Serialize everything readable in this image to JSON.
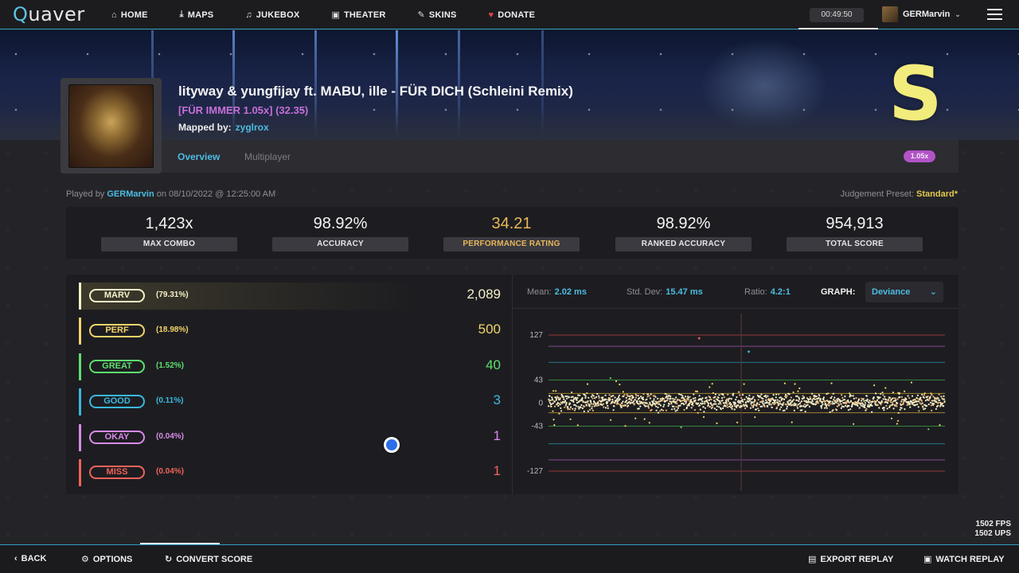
{
  "app": {
    "logo_text": "uaver",
    "logo_q": "Q"
  },
  "nav": {
    "items": [
      {
        "label": "HOME",
        "icon": "home-icon"
      },
      {
        "label": "MAPS",
        "icon": "download-icon"
      },
      {
        "label": "JUKEBOX",
        "icon": "music-icon"
      },
      {
        "label": "THEATER",
        "icon": "camera-icon"
      },
      {
        "label": "SKINS",
        "icon": "brush-icon"
      },
      {
        "label": "DONATE",
        "icon": "heart-icon"
      }
    ],
    "clock": "00:49:50",
    "username": "GERMarvin"
  },
  "map": {
    "title": "lityway & yungfijay ft. MABU, ille - FÜR DICH (Schleini Remix)",
    "difficulty": "[FÜR IMMER 1.05x] (32.35)",
    "mapped_by_label": "Mapped by:",
    "mapper": "zyglrox",
    "grade": "S"
  },
  "tabs": {
    "overview": "Overview",
    "multiplayer": "Multiplayer",
    "mod_badge": "1.05x"
  },
  "played": {
    "prefix": "Played by",
    "player": "GERMarvin",
    "suffix": "on 08/10/2022 @ 12:25:00 AM",
    "preset_label": "Judgement Preset:",
    "preset_value": "Standard*"
  },
  "stats": [
    {
      "value": "1,423x",
      "label": "MAX COMBO"
    },
    {
      "value": "98.92%",
      "label": "ACCURACY"
    },
    {
      "value": "34.21",
      "label": "PERFORMANCE RATING"
    },
    {
      "value": "98.92%",
      "label": "RANKED ACCURACY"
    },
    {
      "value": "954,913",
      "label": "TOTAL SCORE"
    }
  ],
  "judgements": [
    {
      "name": "MARV",
      "pct": "(79.31%)",
      "count": "2,089",
      "color": "#f5f0c8"
    },
    {
      "name": "PERF",
      "pct": "(18.98%)",
      "count": "500",
      "color": "#f2d46a"
    },
    {
      "name": "GREAT",
      "pct": "(1.52%)",
      "count": "40",
      "color": "#5ee06e"
    },
    {
      "name": "GOOD",
      "pct": "(0.11%)",
      "count": "3",
      "color": "#3ab8e0"
    },
    {
      "name": "OKAY",
      "pct": "(0.04%)",
      "count": "1",
      "color": "#d98ae8"
    },
    {
      "name": "MISS",
      "pct": "(0.04%)",
      "count": "1",
      "color": "#f0625a"
    }
  ],
  "graph": {
    "mean_label": "Mean:",
    "mean": "2.02 ms",
    "std_label": "Std. Dev:",
    "std": "15.47 ms",
    "ratio_label": "Ratio:",
    "ratio": "4.2:1",
    "graph_label": "GRAPH:",
    "graph_mode": "Deviance",
    "y_ticks": [
      "127",
      "43",
      "0",
      "-43",
      "-127"
    ]
  },
  "chart_data": {
    "type": "scatter",
    "title": "",
    "xlabel": "",
    "ylabel": "",
    "ylim": [
      -127,
      127
    ],
    "y_ticks": [
      127,
      43,
      0,
      -43,
      -127
    ],
    "threshold_lines": [
      {
        "value": 127,
        "color": "#b9403a"
      },
      {
        "value": 106,
        "color": "#a855b8"
      },
      {
        "value": 76,
        "color": "#2f8fb0"
      },
      {
        "value": 43,
        "color": "#3aa84a"
      },
      {
        "value": 18,
        "color": "#c9a53a"
      },
      {
        "value": -18,
        "color": "#c9a53a"
      },
      {
        "value": -43,
        "color": "#3aa84a"
      },
      {
        "value": -76,
        "color": "#2f8fb0"
      },
      {
        "value": -106,
        "color": "#a855b8"
      },
      {
        "value": -127,
        "color": "#b9403a"
      }
    ],
    "note_count": 2634,
    "outliers": [
      {
        "x": 0.38,
        "y": 121,
        "color": "#f0625a"
      },
      {
        "x": 0.505,
        "y": 96,
        "color": "#3ab8e0"
      }
    ]
  },
  "bottom": {
    "back": "BACK",
    "options": "OPTIONS",
    "convert": "CONVERT SCORE",
    "export": "EXPORT REPLAY",
    "watch": "WATCH REPLAY"
  },
  "fps": {
    "fps": "1502 FPS",
    "ups": "1502 UPS"
  }
}
